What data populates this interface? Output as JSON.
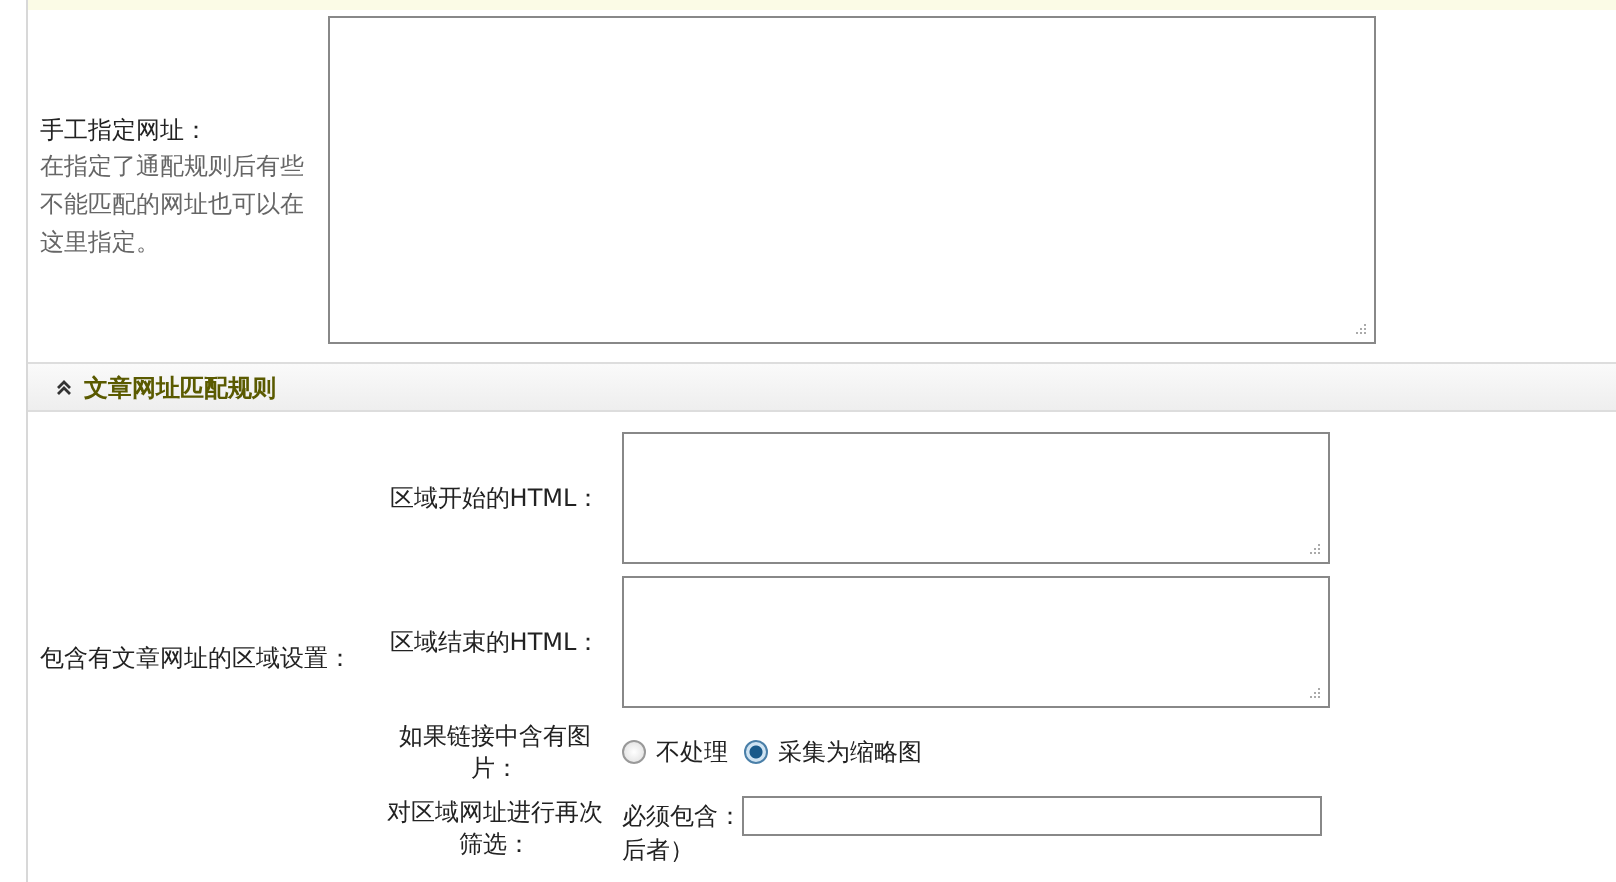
{
  "manual_url": {
    "label": "手工指定网址：",
    "hint": "在指定了通配规则后有些不能匹配的网址也可以在这里指定。"
  },
  "section": {
    "title": "文章网址匹配规则",
    "expanded": true
  },
  "region": {
    "label": "包含有文章网址的区域设置：",
    "start_label": "区域开始的HTML：",
    "end_label": "区域结束的HTML：",
    "image_label": "如果链接中含有图片：",
    "image_options": [
      {
        "label": "不处理",
        "selected": false
      },
      {
        "label": "采集为缩略图",
        "selected": true
      }
    ],
    "filter_label": "对区域网址进行再次筛选：",
    "must_contain_label": "必须包含：",
    "note": "后者）"
  }
}
